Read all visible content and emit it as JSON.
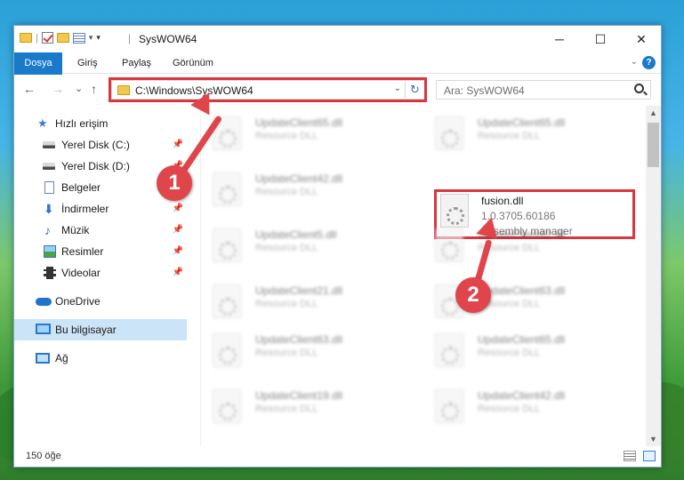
{
  "window": {
    "title": "SysWOW64",
    "controls": {
      "minimize": "─",
      "maximize": "☐",
      "close": "✕"
    }
  },
  "ribbon": {
    "tabs": [
      "Dosya",
      "Giriş",
      "Paylaş",
      "Görünüm"
    ],
    "help": "?"
  },
  "navigation": {
    "back": "←",
    "forward": "→",
    "recent": "⌄",
    "up": "↑",
    "address": "C:\\Windows\\SysWOW64",
    "search_placeholder": "Ara: SysWOW64"
  },
  "sidebar": {
    "items": [
      {
        "label": "Hızlı erişim",
        "icon": "star-icon"
      },
      {
        "label": "Yerel Disk (C:)",
        "icon": "disk-icon",
        "pinned": true
      },
      {
        "label": "Yerel Disk (D:)",
        "icon": "disk-icon",
        "pinned": true
      },
      {
        "label": "Belgeler",
        "icon": "document-icon",
        "pinned": true
      },
      {
        "label": "İndirmeler",
        "icon": "download-icon",
        "pinned": true
      },
      {
        "label": "Müzik",
        "icon": "music-icon",
        "pinned": true
      },
      {
        "label": "Resimler",
        "icon": "pictures-icon",
        "pinned": true
      },
      {
        "label": "Videolar",
        "icon": "video-icon",
        "pinned": true
      },
      {
        "label": "OneDrive",
        "icon": "cloud-icon"
      },
      {
        "label": "Bu bilgisayar",
        "icon": "computer-icon",
        "selected": true
      },
      {
        "label": "Ağ",
        "icon": "network-icon"
      }
    ]
  },
  "files": {
    "left": [
      {
        "name": "UpdateClient65.dll",
        "type": "Resource DLL"
      },
      {
        "name": "UpdateClient42.dll",
        "type": "Resource DLL"
      },
      {
        "name": "UpdateClient5.dll",
        "type": "Resource DLL"
      },
      {
        "name": "UpdateClient21.dll",
        "type": "Resource DLL"
      },
      {
        "name": "UpdateClient63.dll",
        "type": "Resource DLL"
      },
      {
        "name": "UpdateClient19.dll",
        "type": "Resource DLL"
      }
    ],
    "right": [
      {
        "name": "UpdateClient65.dll",
        "type": "Resource DLL"
      },
      {
        "name": "UpdateClient42.dll",
        "type": "Resource DLL"
      },
      {
        "name": "UpdateClient63.dll",
        "type": "Resource DLL"
      },
      {
        "name": "UpdateClient65.dll",
        "type": "Resource DLL"
      },
      {
        "name": "UpdateClient42.dll",
        "type": "Resource DLL"
      }
    ],
    "highlighted": {
      "name": "fusion.dll",
      "version": "1.0.3705.60186",
      "description": "Assembly manager"
    }
  },
  "status": {
    "count": "150 öğe"
  },
  "annotations": {
    "step1": "1",
    "step2": "2",
    "color": "#e0454c"
  }
}
